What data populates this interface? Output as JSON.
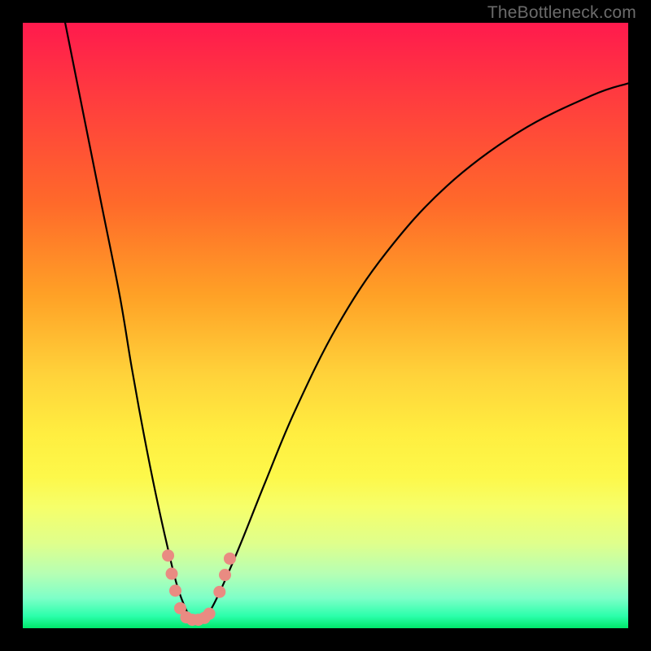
{
  "watermark": "TheBottleneck.com",
  "colors": {
    "frame": "#000000",
    "gradient_top": "#ff1a4d",
    "gradient_bottom": "#00e86b",
    "curve": "#000000",
    "marker": "#e98b82"
  },
  "chart_data": {
    "type": "line",
    "title": "",
    "xlabel": "",
    "ylabel": "",
    "xlim": [
      0,
      100
    ],
    "ylim": [
      0,
      100
    ],
    "grid": false,
    "legend": false,
    "note": "Axes are unlabeled in the image; x/y expressed as 0–100 percent of plot area. y increases upward (0 = green bottom, 100 = red top).",
    "series": [
      {
        "name": "bottleneck-curve",
        "x": [
          7,
          10,
          13,
          16,
          18,
          20,
          22,
          24,
          25.5,
          27,
          28,
          29.5,
          31,
          33,
          36,
          40,
          45,
          52,
          60,
          70,
          82,
          94,
          100
        ],
        "y": [
          100,
          85,
          70,
          55,
          43,
          32,
          22,
          13,
          7,
          3,
          1.5,
          1.5,
          3,
          7,
          14,
          24,
          36,
          50,
          62,
          73,
          82,
          88,
          90
        ]
      }
    ],
    "markers": {
      "name": "highlight-points",
      "note": "Salmon scatter points clustered near the curve minimum.",
      "points": [
        {
          "x": 24.0,
          "y": 12.0
        },
        {
          "x": 24.6,
          "y": 9.0
        },
        {
          "x": 25.2,
          "y": 6.2
        },
        {
          "x": 26.0,
          "y": 3.3
        },
        {
          "x": 27.0,
          "y": 1.8
        },
        {
          "x": 28.0,
          "y": 1.4
        },
        {
          "x": 29.0,
          "y": 1.4
        },
        {
          "x": 30.0,
          "y": 1.7
        },
        {
          "x": 30.8,
          "y": 2.4
        },
        {
          "x": 32.5,
          "y": 6.0
        },
        {
          "x": 33.4,
          "y": 8.8
        },
        {
          "x": 34.2,
          "y": 11.5
        }
      ]
    }
  }
}
